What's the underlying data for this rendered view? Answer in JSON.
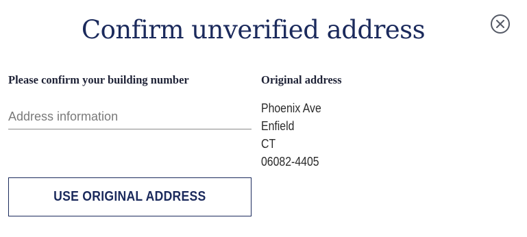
{
  "modal": {
    "title": "Confirm unverified address"
  },
  "building_number": {
    "label": "Please confirm your building number",
    "input_value": "",
    "input_placeholder": "Address information"
  },
  "original_address": {
    "label": "Original address",
    "lines": [
      "Phoenix Ave",
      "Enfield",
      "CT",
      "06082-4405"
    ]
  },
  "actions": {
    "use_original_label": "USE ORIGINAL ADDRESS"
  },
  "icons": {
    "close": "close-circle-icon"
  },
  "colors": {
    "brand_navy": "#1b2a5c",
    "text_dark": "#1e2236",
    "icon_gray": "#555a66"
  }
}
